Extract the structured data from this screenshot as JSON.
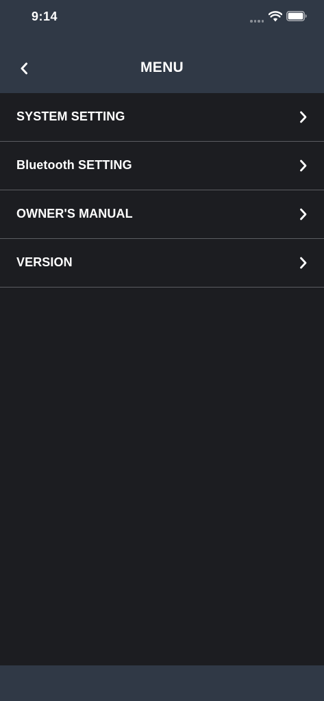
{
  "status_bar": {
    "time": "9:14",
    "icons": [
      "signal-icon",
      "wifi-icon",
      "battery-icon"
    ]
  },
  "nav": {
    "title": "MENU",
    "back_icon": "chevron-left-icon"
  },
  "menu": {
    "items": [
      {
        "label": "SYSTEM SETTING",
        "icon": "chevron-right-icon"
      },
      {
        "label": "Bluetooth SETTING",
        "icon": "chevron-right-icon"
      },
      {
        "label": "OWNER'S MANUAL",
        "icon": "chevron-right-icon"
      },
      {
        "label": "VERSION",
        "icon": "chevron-right-icon"
      }
    ]
  },
  "colors": {
    "header_bg": "#303946",
    "page_bg": "#1c1d21",
    "divider": "#5c5e63",
    "text": "#ffffff"
  }
}
